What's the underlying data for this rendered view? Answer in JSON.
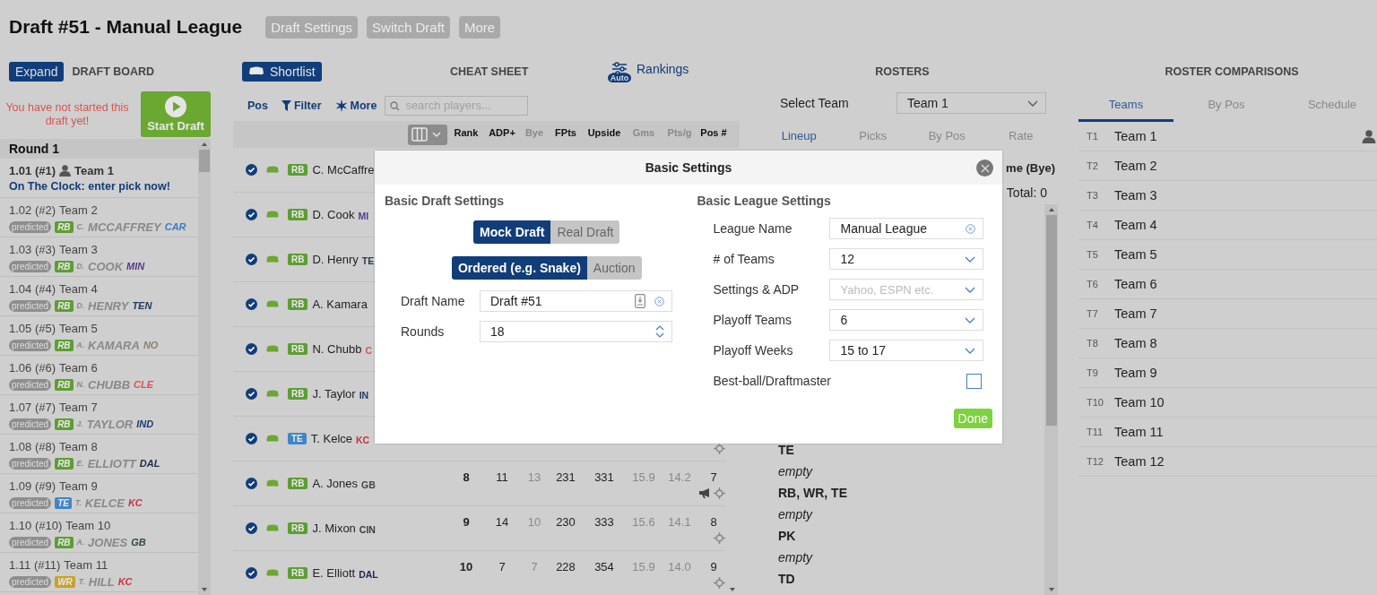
{
  "header": {
    "title": "Draft #51 - Manual League",
    "buttons": [
      "Draft Settings",
      "Switch Draft",
      "More"
    ]
  },
  "draft_board": {
    "expand": "Expand",
    "title": "DRAFT BOARD",
    "notice": "You have not started this draft yet!",
    "start": "Start Draft",
    "round": "Round 1",
    "picks": [
      {
        "kind": "on_clock",
        "pick": "1.01 (#1)",
        "team": "Team 1",
        "mine": true,
        "status": "On The Clock: enter pick now!"
      },
      {
        "kind": "predicted",
        "pick": "1.02 (#2)",
        "team": "Team 2",
        "mine": false,
        "tag": "predicted",
        "pos": "RB",
        "color": "#5d9e32",
        "first": "C.",
        "last": "MCCAFFREY",
        "nfl": {
          "text": "CAR",
          "color": "#3b7bbf"
        }
      },
      {
        "kind": "predicted",
        "pick": "1.03 (#3)",
        "team": "Team 3",
        "mine": false,
        "tag": "predicted",
        "pos": "RB",
        "color": "#5d9e32",
        "first": "D.",
        "last": "COOK",
        "nfl": {
          "text": "MIN",
          "color": "#553a86"
        }
      },
      {
        "kind": "predicted",
        "pick": "1.04 (#4)",
        "team": "Team 4",
        "mine": false,
        "tag": "predicted",
        "pos": "RB",
        "color": "#5d9e32",
        "first": "D.",
        "last": "HENRY",
        "nfl": {
          "text": "TEN",
          "color": "#243a5e"
        }
      },
      {
        "kind": "predicted",
        "pick": "1.05 (#5)",
        "team": "Team 5",
        "mine": false,
        "tag": "predicted",
        "pos": "RB",
        "color": "#5d9e32",
        "first": "A.",
        "last": "KAMARA",
        "nfl": {
          "text": "NO",
          "color": "#8a8270"
        }
      },
      {
        "kind": "predicted",
        "pick": "1.06 (#6)",
        "team": "Team 6",
        "mine": false,
        "tag": "predicted",
        "pos": "RB",
        "color": "#5d9e32",
        "first": "N.",
        "last": "CHUBB",
        "nfl": {
          "text": "CLE",
          "color": "#d9534f"
        }
      },
      {
        "kind": "predicted",
        "pick": "1.07 (#7)",
        "team": "Team 7",
        "mine": false,
        "tag": "predicted",
        "pos": "RB",
        "color": "#5d9e32",
        "first": "J.",
        "last": "TAYLOR",
        "nfl": {
          "text": "IND",
          "color": "#1f3a6e"
        }
      },
      {
        "kind": "predicted",
        "pick": "1.08 (#8)",
        "team": "Team 8",
        "mine": false,
        "tag": "predicted",
        "pos": "RB",
        "color": "#5d9e32",
        "first": "E.",
        "last": "ELLIOTT",
        "nfl": {
          "text": "DAL",
          "color": "#1a2b4c"
        }
      },
      {
        "kind": "predicted",
        "pick": "1.09 (#9)",
        "team": "Team 9",
        "mine": false,
        "tag": "predicted",
        "pos": "TE",
        "color": "#3f86c4",
        "first": "T.",
        "last": "KELCE",
        "nfl": {
          "text": "KC",
          "color": "#c8323c"
        }
      },
      {
        "kind": "predicted",
        "pick": "1.10 (#10)",
        "team": "Team 10",
        "mine": false,
        "tag": "predicted",
        "pos": "RB",
        "color": "#5d9e32",
        "first": "A.",
        "last": "JONES",
        "nfl": {
          "text": "GB",
          "color": "#2f4a3a"
        }
      },
      {
        "kind": "predicted",
        "pick": "1.11 (#11)",
        "team": "Team 11",
        "mine": false,
        "tag": "predicted",
        "pos": "WR",
        "color": "#c9a227",
        "first": "T.",
        "last": "HILL",
        "nfl": {
          "text": "KC",
          "color": "#c8323c"
        }
      }
    ]
  },
  "cheat_sheet": {
    "shortlist": "Shortlist",
    "title": "CHEAT SHEET",
    "rankings": "Rankings",
    "auto": "Auto",
    "toolbar": {
      "pos": "Pos",
      "filter": "Filter",
      "more": "More",
      "placeholder": "search players..."
    },
    "columns": [
      {
        "label": "Rank",
        "muted": false
      },
      {
        "label": "ADP+",
        "muted": false
      },
      {
        "label": "Bye",
        "muted": true
      },
      {
        "label": "FPts",
        "muted": false
      },
      {
        "label": "Upside",
        "muted": false
      },
      {
        "label": "Gms",
        "muted": true
      },
      {
        "label": "Pts/g",
        "muted": true
      },
      {
        "label": "Pos #",
        "muted": false
      }
    ],
    "players": [
      {
        "pos": "RB",
        "color": "#5d9e32",
        "name": "C. McCaffre"
      },
      {
        "pos": "RB",
        "color": "#5d9e32",
        "name": "D. Cook",
        "nfl": {
          "text": "MI",
          "color": "#553a86"
        }
      },
      {
        "pos": "RB",
        "color": "#5d9e32",
        "name": "D. Henry",
        "nfl": {
          "text": "TE",
          "color": "#243a5e"
        }
      },
      {
        "pos": "RB",
        "color": "#5d9e32",
        "name": "A. Kamara"
      },
      {
        "pos": "RB",
        "color": "#5d9e32",
        "name": "N. Chubb",
        "nfl": {
          "text": "C",
          "color": "#d9534f"
        }
      },
      {
        "pos": "RB",
        "color": "#5d9e32",
        "name": "J. Taylor",
        "nfl": {
          "text": "IN",
          "color": "#1f3a6e"
        }
      },
      {
        "pos": "TE",
        "color": "#3f86c4",
        "name": "T. Kelce",
        "nfl": {
          "text": "KC",
          "color": "#c8323c"
        },
        "target": true
      },
      {
        "pos": "RB",
        "color": "#5d9e32",
        "name": "A. Jones",
        "nfl": {
          "text": "GB",
          "color": "#3a4a40"
        },
        "target": true,
        "news": true,
        "stats": [
          "8",
          "11",
          "13",
          "231",
          "331",
          "15.9",
          "14.2",
          "7"
        ]
      },
      {
        "pos": "RB",
        "color": "#5d9e32",
        "name": "J. Mixon",
        "nfl": {
          "text": "CIN",
          "color": "#3a3a3a"
        },
        "target": true,
        "news": false,
        "stats": [
          "9",
          "14",
          "10",
          "230",
          "333",
          "15.6",
          "14.1",
          "8"
        ]
      },
      {
        "pos": "RB",
        "color": "#5d9e32",
        "name": "E. Elliott",
        "nfl": {
          "text": "DAL",
          "color": "#1a2b4c"
        },
        "target": true,
        "news": false,
        "stats": [
          "10",
          "7",
          "7",
          "228",
          "354",
          "15.9",
          "14.0",
          "9"
        ]
      }
    ]
  },
  "rosters": {
    "title": "ROSTERS",
    "select_label": "Select Team",
    "select_value": "Team 1",
    "tabs": [
      {
        "label": "Lineup",
        "selected": true
      },
      {
        "label": "Picks",
        "selected": false
      },
      {
        "label": "By Pos",
        "selected": false
      },
      {
        "label": "Rate",
        "selected": false
      }
    ],
    "column_heading": "me (Bye)",
    "total": "Total: 0",
    "lines": [
      {
        "kind": "slot",
        "text": "TE"
      },
      {
        "kind": "empty",
        "text": "empty"
      },
      {
        "kind": "slot",
        "text": "RB, WR, TE"
      },
      {
        "kind": "empty",
        "text": "empty"
      },
      {
        "kind": "slot",
        "text": "PK"
      },
      {
        "kind": "empty",
        "text": "empty"
      },
      {
        "kind": "slot",
        "text": "TD"
      }
    ]
  },
  "roster_comparisons": {
    "title": "ROSTER COMPARISONS",
    "tabs": [
      {
        "label": "Teams",
        "selected": true
      },
      {
        "label": "By Pos",
        "selected": false
      },
      {
        "label": "Schedule",
        "selected": false
      }
    ],
    "teams": [
      {
        "code": "T1",
        "name": "Team 1",
        "mine": true
      },
      {
        "code": "T2",
        "name": "Team 2",
        "mine": false
      },
      {
        "code": "T3",
        "name": "Team 3",
        "mine": false
      },
      {
        "code": "T4",
        "name": "Team 4",
        "mine": false
      },
      {
        "code": "T5",
        "name": "Team 5",
        "mine": false
      },
      {
        "code": "T6",
        "name": "Team 6",
        "mine": false
      },
      {
        "code": "T7",
        "name": "Team 7",
        "mine": false
      },
      {
        "code": "T8",
        "name": "Team 8",
        "mine": false
      },
      {
        "code": "T9",
        "name": "Team 9",
        "mine": false
      },
      {
        "code": "T10",
        "name": "Team 10",
        "mine": false
      },
      {
        "code": "T11",
        "name": "Team 11",
        "mine": false
      },
      {
        "code": "T12",
        "name": "Team 12",
        "mine": false
      }
    ]
  },
  "modal": {
    "title": "Basic Settings",
    "done": "Done",
    "draft": {
      "title": "Basic Draft Settings",
      "toggles": [
        [
          {
            "label": "Mock Draft",
            "selected": true
          },
          {
            "label": "Real Draft",
            "selected": false
          }
        ],
        [
          {
            "label": "Ordered (e.g. Snake)",
            "selected": true
          },
          {
            "label": "Auction",
            "selected": false
          }
        ]
      ],
      "fields": [
        {
          "kind": "text",
          "label": "Draft Name",
          "value": "Draft #51"
        },
        {
          "kind": "number",
          "label": "Rounds",
          "value": "18"
        }
      ]
    },
    "league": {
      "title": "Basic League Settings",
      "fields": [
        {
          "kind": "text",
          "label": "League Name",
          "value": "Manual League"
        },
        {
          "kind": "select",
          "label": "# of Teams",
          "value": "12"
        },
        {
          "kind": "select",
          "label": "Settings & ADP",
          "placeholder": "Yahoo, ESPN etc."
        },
        {
          "kind": "select",
          "label": "Playoff Teams",
          "value": "6"
        },
        {
          "kind": "select",
          "label": "Playoff Weeks",
          "value": "15 to 17"
        },
        {
          "kind": "checkbox",
          "label": "Best-ball/Draftmaster",
          "checked": false
        }
      ]
    }
  }
}
